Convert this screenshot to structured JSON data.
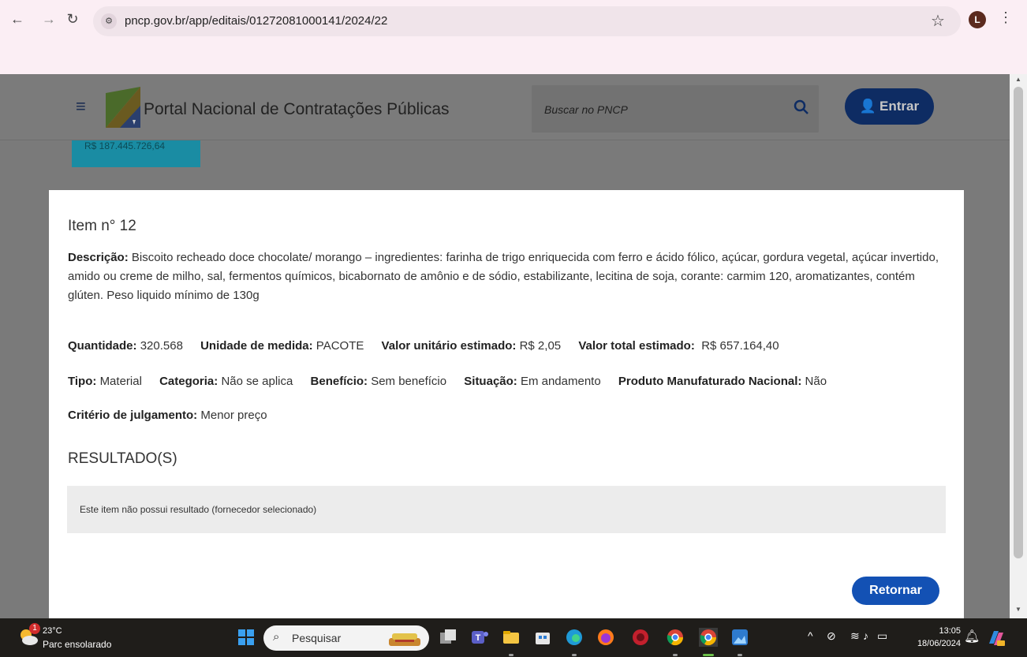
{
  "browser": {
    "url": "pncp.gov.br/app/editais/01272081000141/2024/22",
    "profile_initial": "L"
  },
  "header": {
    "portal_title": "Portal Nacional de Contratações Públicas",
    "search_placeholder": "Buscar no PNCP",
    "login_label": "Entrar"
  },
  "background_tile": {
    "value": "R$ 187.445.726,64"
  },
  "item": {
    "title": "Item n° 12",
    "descricao_label": "Descrição:",
    "descricao_value": "Biscoito recheado doce chocolate/ morango – ingredientes: farinha de trigo enriquecida com ferro e ácido fólico, açúcar, gordura vegetal, açúcar invertido, amido ou creme de milho, sal, fermentos químicos, bicabornato de amônio e de sódio, estabilizante, lecitina de soja, corante: carmim 120, aromatizantes, contém glúten. Peso liquido mínimo de 130g",
    "quantidade_label": "Quantidade:",
    "quantidade_value": "320.568",
    "unidade_label": "Unidade de medida:",
    "unidade_value": "PACOTE",
    "valor_unitario_label": "Valor unitário estimado:",
    "valor_unitario_value": "R$ 2,05",
    "valor_total_label": "Valor total estimado:",
    "valor_total_value": "R$ 657.164,40",
    "tipo_label": "Tipo:",
    "tipo_value": "Material",
    "categoria_label": "Categoria:",
    "categoria_value": "Não se aplica",
    "beneficio_label": "Benefício:",
    "beneficio_value": "Sem benefício",
    "situacao_label": "Situação:",
    "situacao_value": "Em andamento",
    "produto_label": "Produto Manufaturado Nacional:",
    "produto_value": "Não",
    "criterio_label": "Critério de julgamento:",
    "criterio_value": "Menor preço",
    "resultados_heading": "RESULTADO(S)",
    "no_result_text": "Este item não possui resultado (fornecedor selecionado)",
    "retornar_label": "Retornar"
  },
  "taskbar": {
    "weather_badge": "1",
    "temperature": "23°C",
    "weather_desc": "Parc ensolarado",
    "search_label": "Pesquisar",
    "time": "13:05",
    "date": "18/06/2024"
  },
  "colors": {
    "primary_blue": "#1351b4",
    "dark_blue_overlay": "#0e2c63",
    "modal_bg": "#ffffff",
    "overlay": "#7a7a7a"
  }
}
